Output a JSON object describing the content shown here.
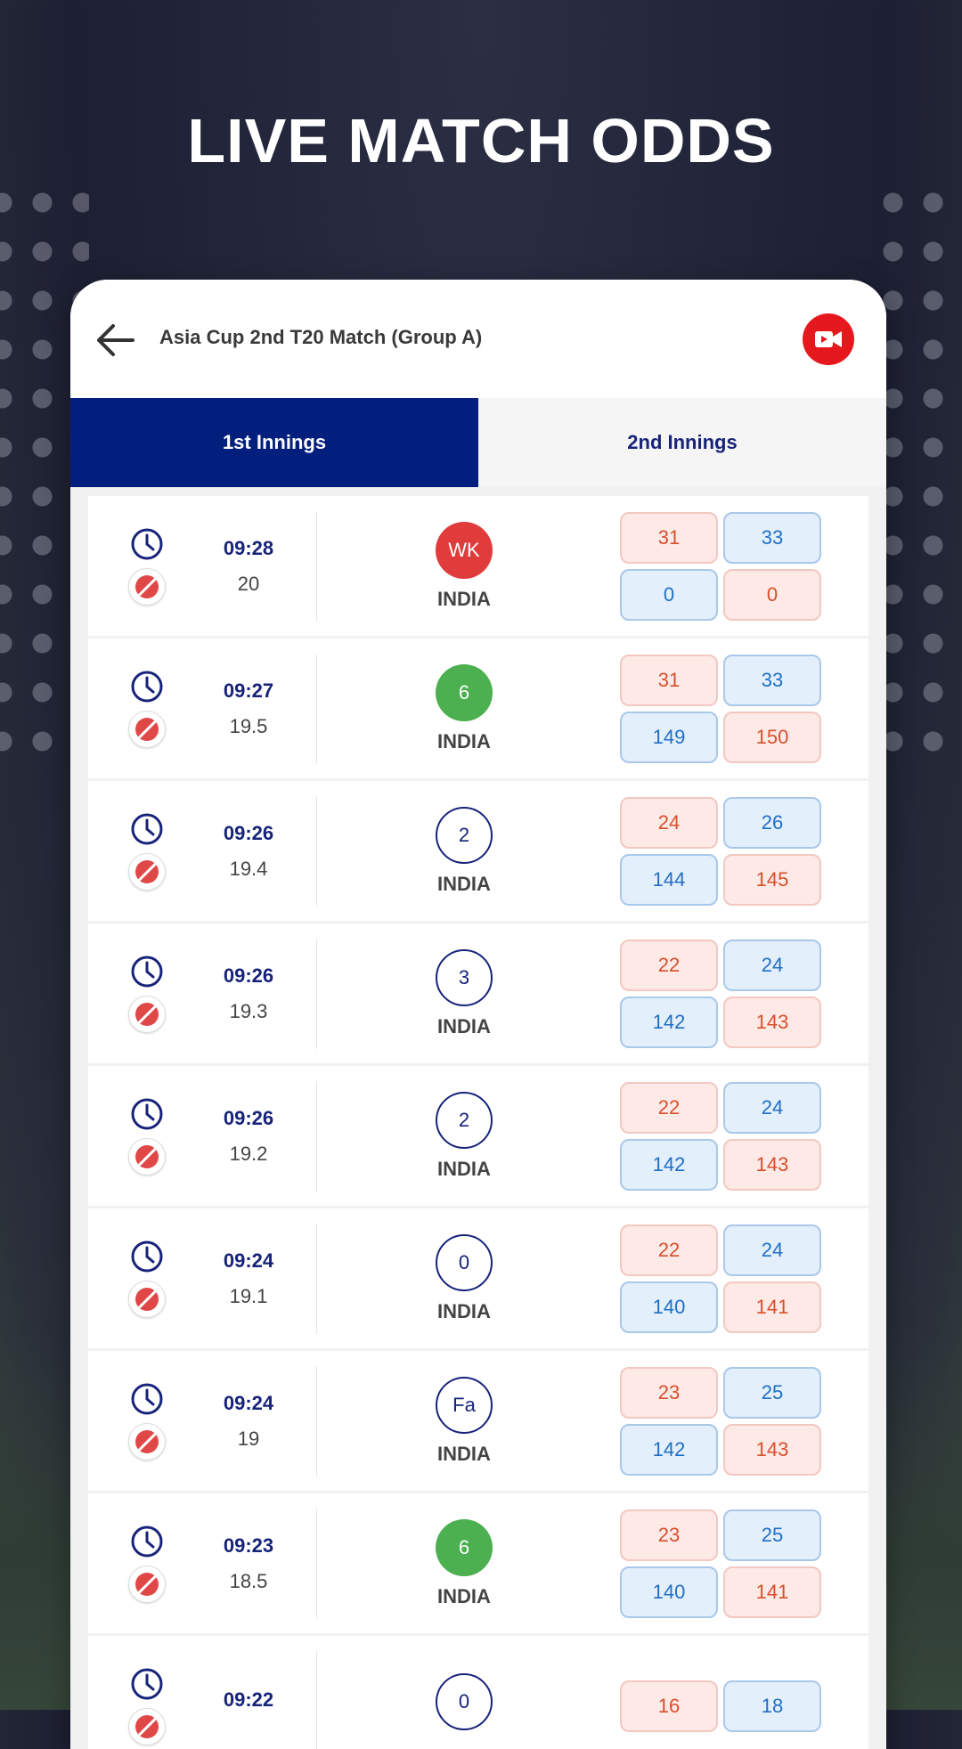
{
  "promo": {
    "title": "LIVE MATCH ODDS"
  },
  "header": {
    "match_title": "Asia Cup 2nd T20 Match (Group A)"
  },
  "tabs": [
    {
      "label": "1st Innings",
      "active": true
    },
    {
      "label": "2nd Innings",
      "active": false
    }
  ],
  "icons": {
    "back": "back-arrow-icon",
    "video": "video-camera-icon",
    "clock": "clock-icon",
    "ball": "cricket-ball-icon"
  },
  "colors": {
    "tab_active": "#021f7d",
    "video_button": "#e5181e",
    "wicket": "#e03c3c",
    "six": "#4caf50",
    "odd_pink_text": "#d94f2b",
    "odd_blue_text": "#1f6fc7"
  },
  "rows": [
    {
      "time": "09:28",
      "over": "20",
      "event": "WK",
      "event_type": "wicket",
      "team": "INDIA",
      "odds": [
        "31",
        "33",
        "0",
        "0"
      ]
    },
    {
      "time": "09:27",
      "over": "19.5",
      "event": "6",
      "event_type": "six",
      "team": "INDIA",
      "odds": [
        "31",
        "33",
        "149",
        "150"
      ]
    },
    {
      "time": "09:26",
      "over": "19.4",
      "event": "2",
      "event_type": "plain",
      "team": "INDIA",
      "odds": [
        "24",
        "26",
        "144",
        "145"
      ]
    },
    {
      "time": "09:26",
      "over": "19.3",
      "event": "3",
      "event_type": "plain",
      "team": "INDIA",
      "odds": [
        "22",
        "24",
        "142",
        "143"
      ]
    },
    {
      "time": "09:26",
      "over": "19.2",
      "event": "2",
      "event_type": "plain",
      "team": "INDIA",
      "odds": [
        "22",
        "24",
        "142",
        "143"
      ]
    },
    {
      "time": "09:24",
      "over": "19.1",
      "event": "0",
      "event_type": "plain",
      "team": "INDIA",
      "odds": [
        "22",
        "24",
        "140",
        "141"
      ]
    },
    {
      "time": "09:24",
      "over": "19",
      "event": "Fa",
      "event_type": "plain",
      "team": "INDIA",
      "odds": [
        "23",
        "25",
        "142",
        "143"
      ]
    },
    {
      "time": "09:23",
      "over": "18.5",
      "event": "6",
      "event_type": "six",
      "team": "INDIA",
      "odds": [
        "23",
        "25",
        "140",
        "141"
      ]
    },
    {
      "time": "09:22",
      "over": "",
      "event": "0",
      "event_type": "plain",
      "team": "",
      "odds": [
        "16",
        "18",
        "",
        ""
      ]
    }
  ]
}
